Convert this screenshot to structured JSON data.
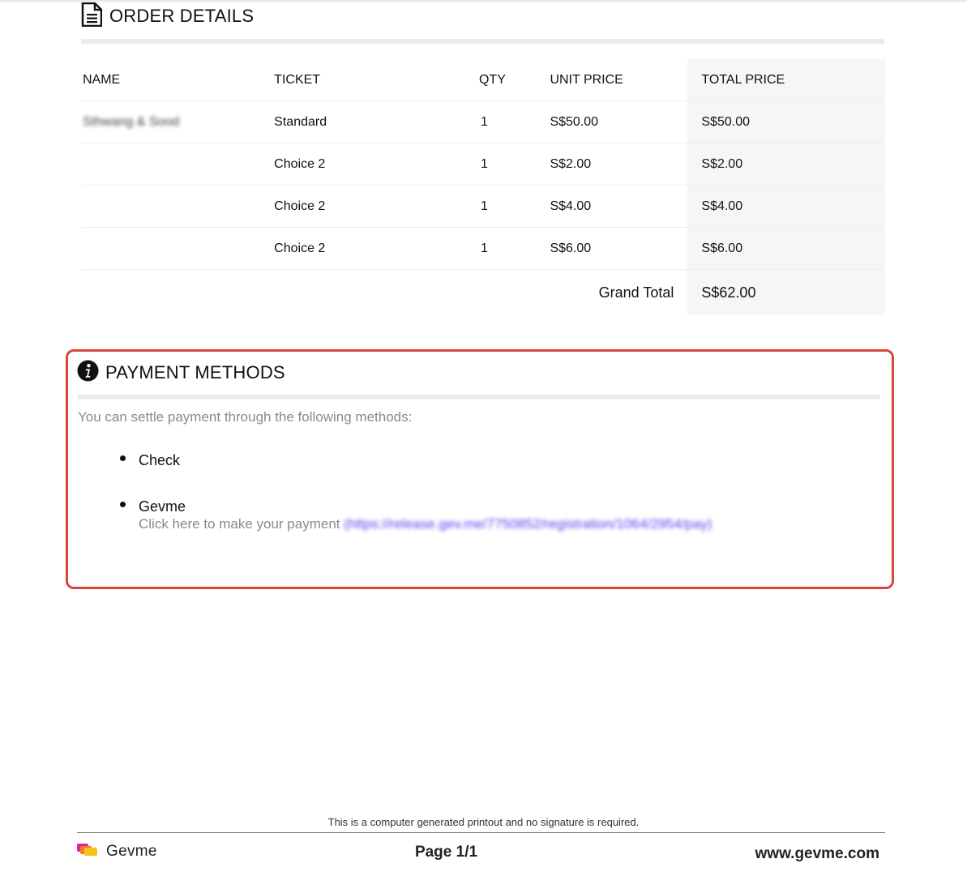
{
  "order_details": {
    "title": "ORDER DETAILS",
    "columns": [
      "NAME",
      "TICKET",
      "QTY",
      "UNIT PRICE",
      "TOTAL PRICE"
    ],
    "rows": [
      {
        "name": "Sthwang & Sood",
        "ticket": "Standard",
        "qty": "1",
        "unit_price": "S$50.00",
        "total_price": "S$50.00"
      },
      {
        "name": "",
        "ticket": "Choice 2",
        "qty": "1",
        "unit_price": "S$2.00",
        "total_price": "S$2.00"
      },
      {
        "name": "",
        "ticket": "Choice 2",
        "qty": "1",
        "unit_price": "S$4.00",
        "total_price": "S$4.00"
      },
      {
        "name": "",
        "ticket": "Choice 2",
        "qty": "1",
        "unit_price": "S$6.00",
        "total_price": "S$6.00"
      }
    ],
    "grand_total_label": "Grand Total",
    "grand_total_value": "S$62.00"
  },
  "payment_methods": {
    "title": "PAYMENT METHODS",
    "intro": "You can settle payment through the following methods:",
    "methods": [
      {
        "label": "Check"
      },
      {
        "label": "Gevme",
        "note": "Click here to make your payment",
        "link": "https://release.gev.me/7750852/registration/1064/2954/pay"
      }
    ]
  },
  "footer": {
    "note": "This is a computer generated printout and no signature is required.",
    "brand": "Gevme",
    "page": "Page 1/1",
    "website": "www.gevme.com"
  },
  "colors": {
    "highlight_border": "#d9473a",
    "link": "#5a3ff0",
    "muted_text": "#8a8a8a",
    "total_column_bg": "#f6f6f6"
  },
  "icons": [
    "document-icon",
    "info-icon",
    "gevme-logo-icon"
  ]
}
